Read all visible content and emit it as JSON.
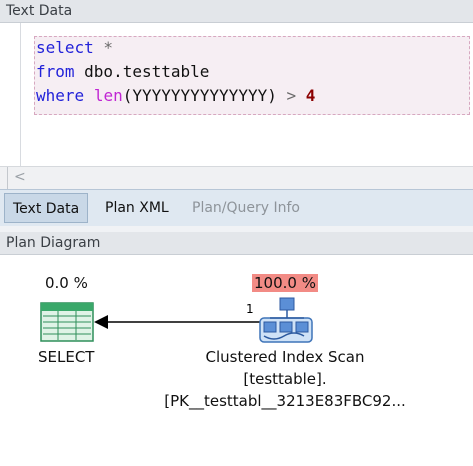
{
  "text_data_panel": {
    "title": "Text Data",
    "code_lines": [
      {
        "parts": [
          {
            "t": "select",
            "c": "kw"
          },
          {
            "t": " *",
            "c": "op"
          }
        ]
      },
      {
        "parts": [
          {
            "t": "from",
            "c": "kw"
          },
          {
            "t": " dbo.testtable",
            "c": "txt"
          }
        ]
      },
      {
        "parts": [
          {
            "t": "where",
            "c": "kw"
          },
          {
            "t": " ",
            "c": "txt"
          },
          {
            "t": "len",
            "c": "fn"
          },
          {
            "t": "(YYYYYYYYYYYYYY)",
            "c": "txt"
          },
          {
            "t": " > ",
            "c": "op"
          },
          {
            "t": "4",
            "c": "num"
          }
        ]
      }
    ],
    "scroll_left_glyph": "<"
  },
  "tabs": [
    {
      "label": "Text Data",
      "state": "active"
    },
    {
      "label": "Plan XML",
      "state": "normal"
    },
    {
      "label": "Plan/Query Info",
      "state": "disabled"
    }
  ],
  "plan_diagram": {
    "title": "Plan Diagram",
    "select_node": {
      "cost": "0.0 %",
      "label": "SELECT"
    },
    "scan_node": {
      "cost": "100.0 %",
      "label_lines": [
        "Clustered Index Scan",
        "[testtable].",
        "[PK__testtabl__3213E83FBC92..."
      ]
    },
    "edge_label": "1"
  },
  "colors": {
    "keyword": "#2323d9",
    "function": "#c026d3",
    "number": "#8b0000",
    "hot_cost": "#f28b85",
    "tab_bar": "#dfe8f1"
  }
}
